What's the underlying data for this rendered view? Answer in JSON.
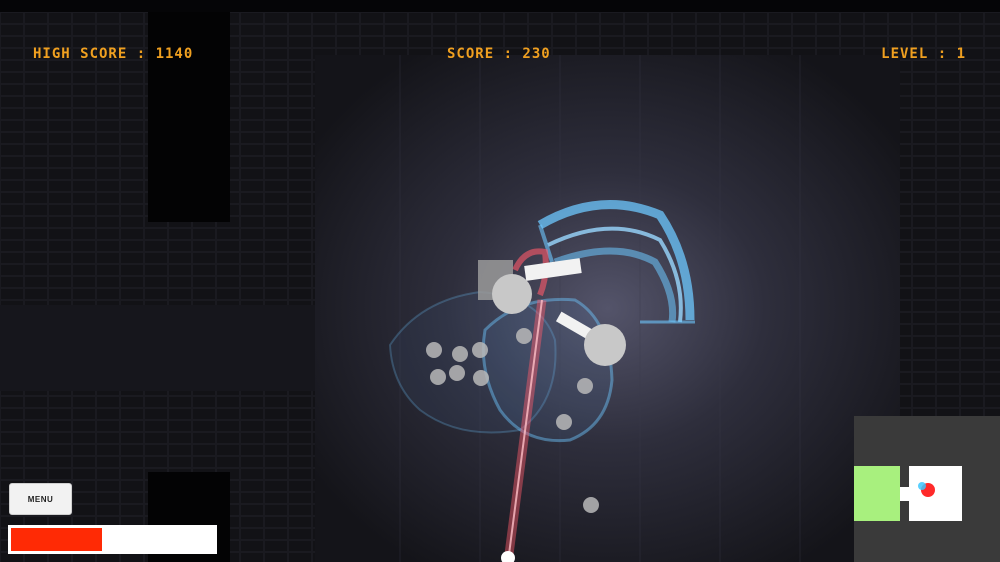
{
  "hud": {
    "high_score": "HIGH SCORE : 1140",
    "score": "SCORE : 230",
    "level": "LEVEL : 1"
  },
  "menu": {
    "label": "MENU"
  },
  "health": {
    "fraction": 0.45,
    "color": "#ff2a05"
  },
  "colors": {
    "hud_text": "#f0a020",
    "floor_light": "#4a4a5e",
    "wall_dark": "#050507",
    "shield_blue": "#6ec8ff",
    "laser_red": "#ff5a6a",
    "minimap_room_visited": "#a8f07e",
    "minimap_player": "#ff2a2a",
    "minimap_enemy": "#3cc8ff"
  },
  "minimap": {
    "visible": true
  }
}
